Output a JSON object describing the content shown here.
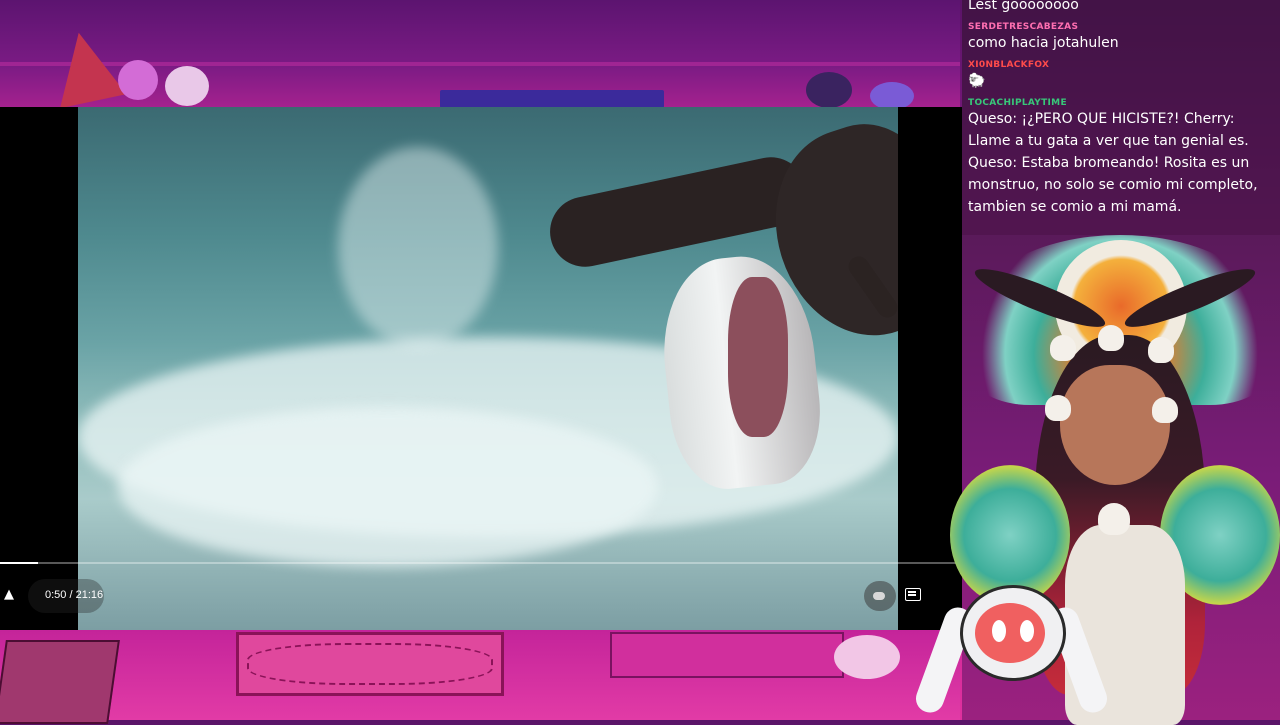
{
  "player": {
    "time_display": "0:50 / 21:16",
    "progress_fraction": 0.039
  },
  "chat": {
    "messages": [
      {
        "user": "",
        "text": "Lest goooooooo",
        "color": "#ffffff"
      },
      {
        "user": "SERDETRESCABEZAS",
        "text": "como hacia jotahulen",
        "color": "#ff6fb1"
      },
      {
        "user": "XI0NBLACKFOX",
        "text": "🐑",
        "color": "#ff4b4b"
      },
      {
        "user": "TOCACHIPLAYTIME",
        "text": "Queso: ¡¿PERO QUE HICISTE?! Cherry: Llame a tu gata a ver que tan genial es. Queso: Estaba bromeando! Rosita es un monstruo, no solo se comio mi completo, tambien se comio a mi mamá.",
        "color": "#38c779"
      }
    ]
  },
  "colors": {
    "chat_bg": "#3a143a",
    "room_accent": "#e0309e"
  }
}
